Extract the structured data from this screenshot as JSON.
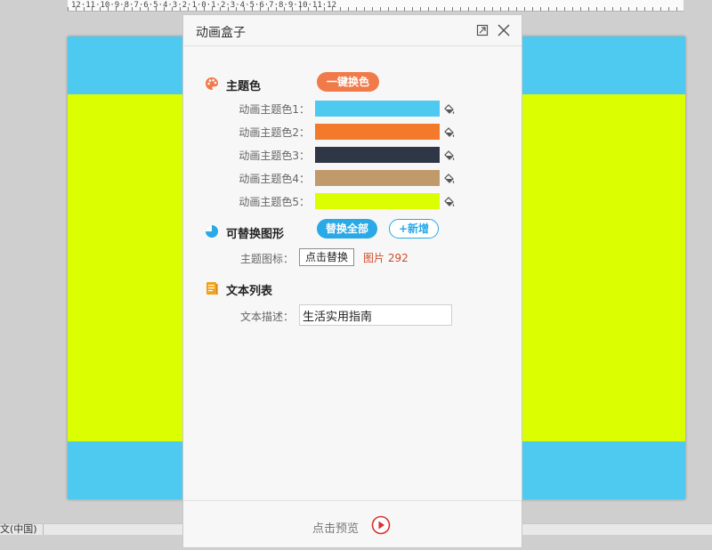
{
  "ruler": {
    "text": "12·11·10·9·8·7·6·5·4·3·2·1·0·1·2·3·4·5·6·7·8·9·10·11·12"
  },
  "slide": {
    "colors": {
      "top": "#4ec9f0",
      "middle": "#dbff00",
      "bottom": "#4ec9f0"
    }
  },
  "status": {
    "language": "文(中国)"
  },
  "panel": {
    "title": "动画盒子",
    "theme_section": {
      "title": "主题色",
      "one_click_label": "一键换色",
      "colors": [
        {
          "label": "动画主题色1：",
          "color": "#4ec9f0"
        },
        {
          "label": "动画主题色2：",
          "color": "#f27a2a"
        },
        {
          "label": "动画主题色3：",
          "color": "#2f3645"
        },
        {
          "label": "动画主题色4：",
          "color": "#c09a6b"
        },
        {
          "label": "动画主题色5：",
          "color": "#dbff00"
        }
      ]
    },
    "shapes_section": {
      "title": "可替换图形",
      "replace_all_label": "替换全部",
      "add_label": "+新增",
      "icon_label": "主题图标：",
      "click_replace_label": "点击替换",
      "picture_ref": "图片 292"
    },
    "text_section": {
      "title": "文本列表",
      "desc_label": "文本描述：",
      "desc_value": "生活实用指南"
    },
    "footer": {
      "preview_label": "点击预览"
    }
  }
}
